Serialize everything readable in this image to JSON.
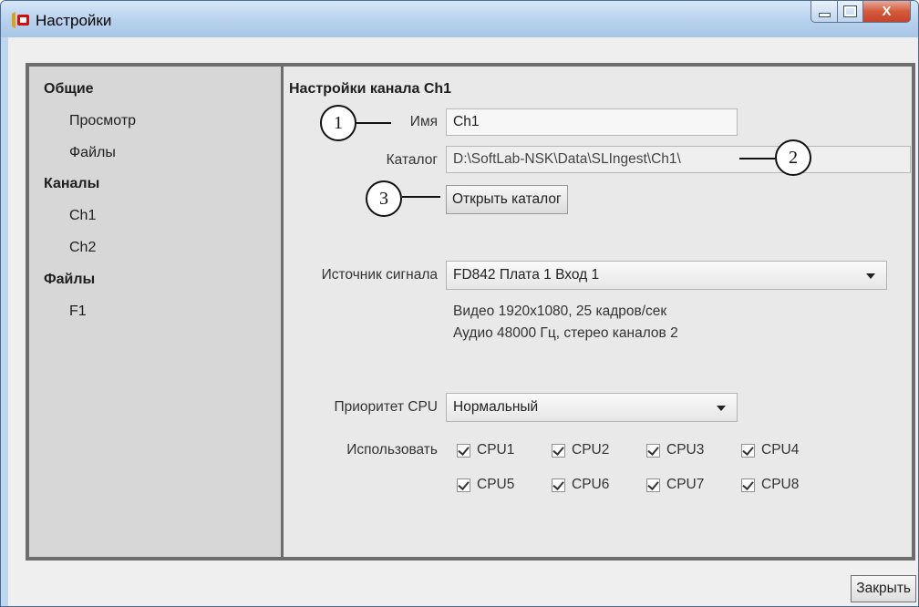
{
  "window": {
    "title": "Настройки",
    "close_glyph": "X"
  },
  "nav": {
    "items": [
      {
        "label": "Общие",
        "level": 0
      },
      {
        "label": "Просмотр",
        "level": 1
      },
      {
        "label": "Файлы",
        "level": 1
      },
      {
        "label": "Каналы",
        "level": 0
      },
      {
        "label": "Ch1",
        "level": 1
      },
      {
        "label": "Ch2",
        "level": 1
      },
      {
        "label": "Файлы",
        "level": 0
      },
      {
        "label": "F1",
        "level": 1
      }
    ]
  },
  "channel": {
    "heading": "Настройки канала Ch1",
    "name_label": "Имя",
    "name_value": "Ch1",
    "catalog_label": "Каталог",
    "catalog_value": "D:\\SoftLab-NSK\\Data\\SLIngest\\Ch1\\",
    "open_catalog_button": "Открыть каталог",
    "source_label": "Источник сигнала",
    "source_value": "FD842 Плата 1 Вход 1",
    "video_info": "Видео 1920x1080, 25 кадров/сек",
    "audio_info": "Аудио 48000 Гц, стерео каналов 2",
    "cpu_priority_label": "Приоритет CPU",
    "cpu_priority_value": "Нормальный",
    "use_label": "Использовать",
    "cpus": [
      {
        "label": "CPU1",
        "checked": true
      },
      {
        "label": "CPU2",
        "checked": true
      },
      {
        "label": "CPU3",
        "checked": true
      },
      {
        "label": "CPU4",
        "checked": true
      },
      {
        "label": "CPU5",
        "checked": true
      },
      {
        "label": "CPU6",
        "checked": true
      },
      {
        "label": "CPU7",
        "checked": true
      },
      {
        "label": "CPU8",
        "checked": true
      }
    ]
  },
  "callouts": [
    "1",
    "2",
    "3"
  ],
  "footer": {
    "close_button": "Закрыть"
  }
}
